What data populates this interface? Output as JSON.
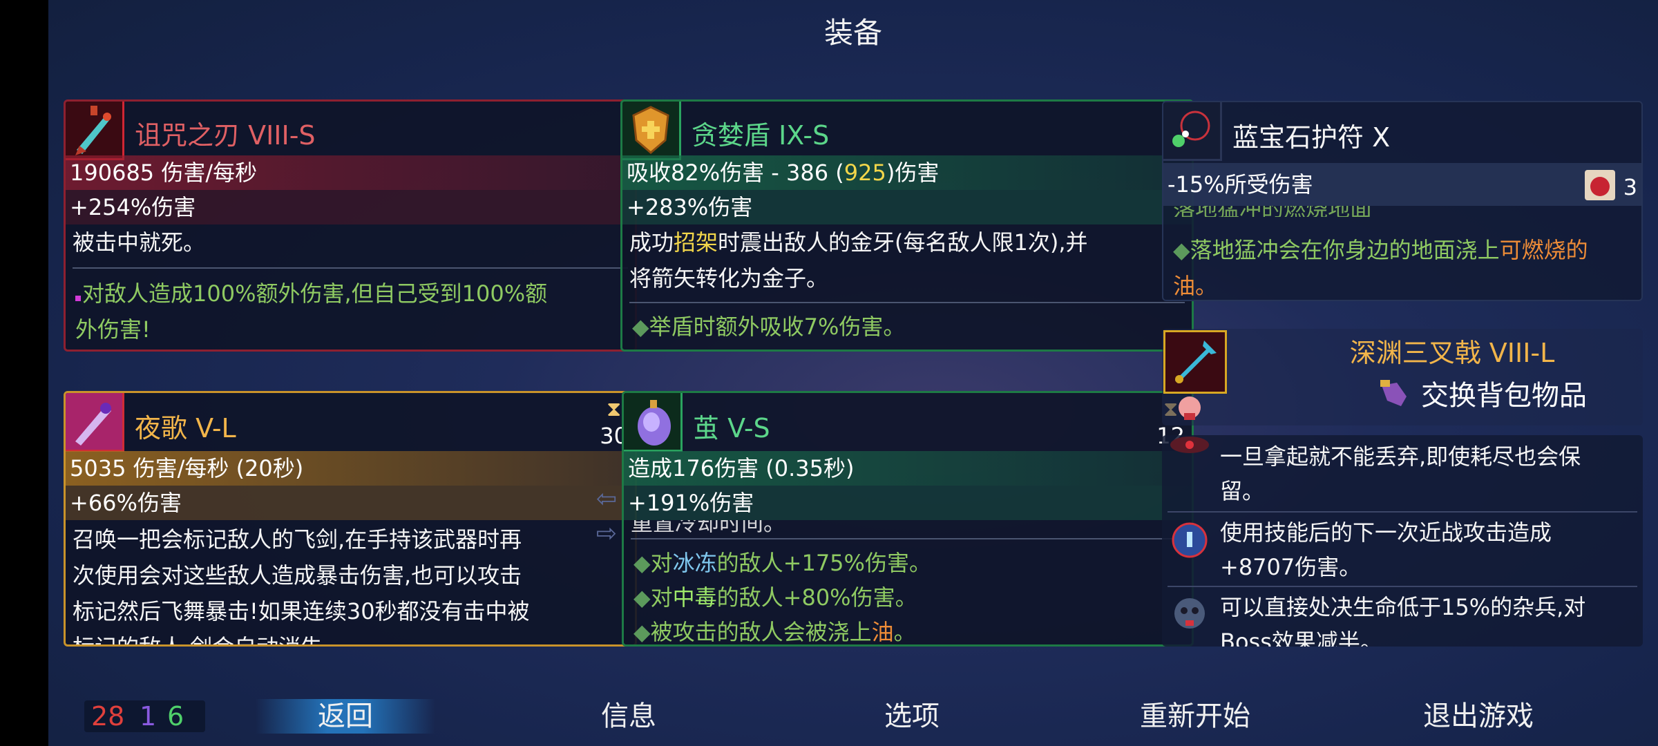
{
  "title": "装备",
  "colors": {
    "red": "#d02633",
    "green": "#2aa35f",
    "gold": "#c9932a",
    "accent_blue": "#2c8ad8"
  },
  "cards": {
    "curse_blade": {
      "icon": "cursed-blade-icon",
      "name": "诅咒之刃 VIII-S",
      "dps": "190685 伤害/每秒",
      "bonus": "+254%伤害",
      "desc": "被击中就死。",
      "effect_line1": "对敌人造成100%额外伤害,但自己受到100%额",
      "effect_line2": "外伤害!"
    },
    "greed_shield": {
      "icon": "greed-shield-icon",
      "name": "贪婪盾 IX-S",
      "absorb_prefix": "吸收82%伤害 - 386 (",
      "absorb_value": "925",
      "absorb_suffix": ")伤害",
      "bonus": "+283%伤害",
      "desc1_pre": "成功",
      "desc1_key": "招架",
      "desc1_post": "时震出敌人的金牙(每名敌人限1次),并",
      "desc2": "将箭矢转化为金子。",
      "effect": "举盾时额外吸收7%伤害。"
    },
    "sapphire": {
      "icon": "sapphire-amulet-icon",
      "name": "蓝宝石护符 X",
      "stat": "-15%所受伤害",
      "scroll_icon": "scroll-icon",
      "scroll_count": "3",
      "cut_text": "落地猛冲的燃烧地面",
      "effect_pre": "落地猛冲会在你身边的地面浇上",
      "effect_key": "可燃烧的",
      "effect_end": "油。"
    },
    "nightsong": {
      "icon": "nightsong-sword-icon",
      "name": "夜歌 V-L",
      "cooldown": "30",
      "dps": "5035 伤害/每秒 (20秒)",
      "bonus": "+66%伤害",
      "desc": [
        "召唤一把会标记敌人的飞剑,在手持该武器时再",
        "次使用会对这些敌人造成暴击伤害,也可以攻击",
        "标记然后飞舞暴击!如果连续30秒都没有击中被",
        "标记的敌人,剑会自动消失。"
      ]
    },
    "cocoon": {
      "icon": "cocoon-icon",
      "name": "茧 V-S",
      "cooldown": "12",
      "dmg": "造成176伤害 (0.35秒)",
      "bonus": "+191%伤害",
      "cut_text": "重置冷却时间。",
      "eff1_pre": "对",
      "eff1_key": "冰冻",
      "eff1_post": "的敌人+175%伤害。",
      "eff2_pre": "对",
      "eff2_key": "中毒",
      "eff2_post": "的敌人+80%伤害。",
      "eff3_pre": "被攻击的敌人会被浇上",
      "eff3_key": "油",
      "eff3_post": "。"
    },
    "trident": {
      "icon": "abyss-trident-icon",
      "name": "深渊三叉戟 VIII-L",
      "swap_icon": "hand-swap-icon",
      "swap_label": "交换背包物品",
      "rows": [
        {
          "icon": "curse-eye-icon",
          "line1": "一旦拿起就不能丢弃,即使耗尽也会保",
          "line2": "留。"
        },
        {
          "icon": "potion-icon",
          "line1": "使用技能后的下一次近战攻击造成",
          "line2": "+8707伤害。"
        },
        {
          "icon": "skull-execute-icon",
          "line1": "可以直接处决生命低于15%的杂兵,对",
          "line2": "Boss效果减半。"
        }
      ]
    }
  },
  "bottom": {
    "counts": {
      "red": "28",
      "purple": "1",
      "green": "6"
    },
    "back": "返回",
    "info": "信息",
    "options": "选项",
    "restart": "重新开始",
    "quit": "退出游戏"
  }
}
